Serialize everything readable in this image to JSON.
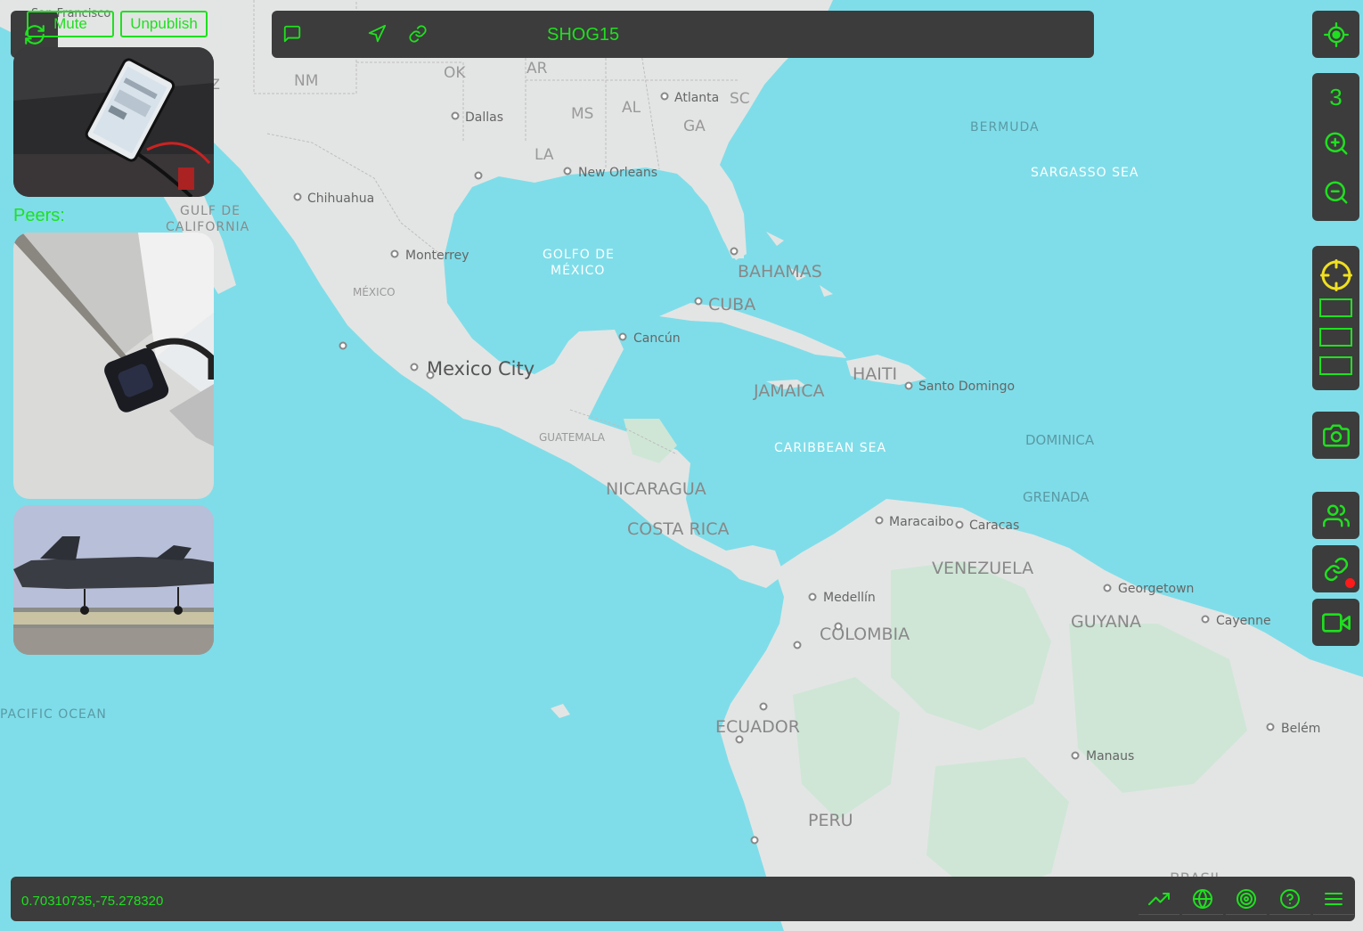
{
  "topbar": {
    "title": "SHOG15"
  },
  "left_panel": {
    "mute_label": "Mute",
    "unpublish_label": "Unpublish",
    "peers_label": "Peers:"
  },
  "zoom": {
    "level": "3"
  },
  "statusbar": {
    "coordinates": "0.70310735,-75.278320"
  },
  "colors": {
    "accent": "#1fe01f",
    "panel": "#3c3c3c",
    "water": "#7fdde9",
    "land": "#e3e5e4",
    "target": "#f0e020",
    "alert": "#ff1a1a"
  },
  "map_labels": {
    "san_francisco": "San Francisco",
    "az": "AZ",
    "nm": "NM",
    "ok": "OK",
    "ar": "AR",
    "ms": "MS",
    "al": "AL",
    "ga": "GA",
    "sc": "SC",
    "la": "LA",
    "atlanta": "Atlanta",
    "dallas": "Dallas",
    "new_orleans": "New Orleans",
    "chihuahua": "Chihuahua",
    "monterrey": "Monterrey",
    "mexico": "MÉXICO",
    "mexico_city": "Mexico City",
    "gulf_ca1": "GULF DE",
    "gulf_ca2": "CALIFORNIA",
    "golfo1": "GOLFO DE",
    "golfo2": "MÉXICO",
    "bermuda": "BERMUDA",
    "sargasso": "SARGASSO SEA",
    "bahamas": "BAHAMAS",
    "cuba": "CUBA",
    "cancun": "Cancún",
    "haiti": "HAITI",
    "santo_domingo": "Santo Domingo",
    "jamaica": "JAMAICA",
    "caribbean": "CARIBBEAN SEA",
    "dominica": "DOMINICA",
    "grenada": "GRENADA",
    "guatemala": "GUATEMALA",
    "nicaragua": "NICARAGUA",
    "costa_rica": "COSTA RICA",
    "maracaibo": "Maracaibo",
    "caracas": "Caracas",
    "venezuela": "VENEZUELA",
    "georgetown": "Georgetown",
    "guyana": "GUYANA",
    "cayenne": "Cayenne",
    "medellin": "Medellín",
    "colombia": "COLOMBIA",
    "ecuador": "ECUADOR",
    "peru": "PERU",
    "manaus": "Manaus",
    "belem": "Belém",
    "brasil": "BRASIL",
    "pacific": "PACIFIC OCEAN"
  },
  "icons": {
    "refresh": "refresh-icon",
    "chat": "chat-icon",
    "navigate": "navigation-arrow-icon",
    "link": "link-icon",
    "locate": "locate-icon",
    "zoom_in": "zoom-in-icon",
    "zoom_out": "zoom-out-icon",
    "crosshair": "crosshair-icon",
    "camera": "camera-icon",
    "users": "users-icon",
    "video": "video-camera-icon",
    "trend": "trending-up-icon",
    "globe": "globe-icon",
    "target": "target-icon",
    "help": "help-circle-icon",
    "menu": "menu-icon"
  }
}
